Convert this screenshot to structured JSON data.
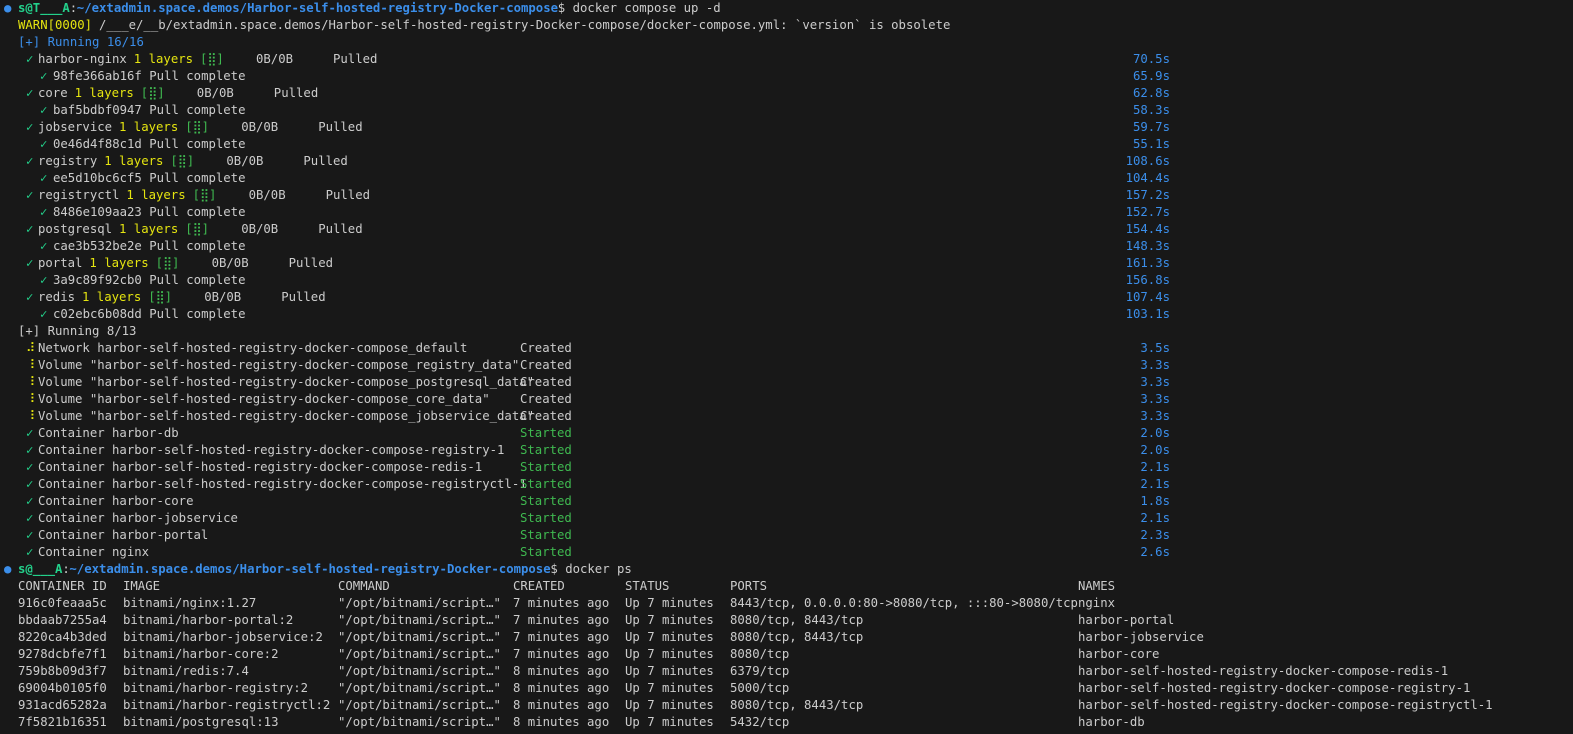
{
  "prompt1": {
    "dot": "●",
    "user_host": "s@T___A",
    "path": "~/extadmin.space.demos/Harbor-self-hosted-registry-Docker-compose",
    "suffix": "$",
    "command": "docker compose up -d"
  },
  "warn": {
    "prefix": "WARN[0000]",
    "text": "/___e/__b/extadmin.space.demos/Harbor-self-hosted-registry-Docker-compose/docker-compose.yml: `version` is obsolete"
  },
  "pull_header": "[+] Running 16/16",
  "pulls": [
    {
      "check": "✓",
      "service": "harbor-nginx",
      "layers": "1 layers",
      "box": "[⣿]",
      "size": "0B/0B",
      "state": "Pulled",
      "dur": "70.5s"
    },
    {
      "check": "✓",
      "layer": "98fe366ab16f Pull complete",
      "dur": "65.9s"
    },
    {
      "check": "✓",
      "service": "core",
      "layers": "1 layers",
      "box": "[⣿]",
      "size": "0B/0B",
      "state": "Pulled",
      "dur": "62.8s"
    },
    {
      "check": "✓",
      "layer": "baf5bdbf0947 Pull complete",
      "dur": "58.3s"
    },
    {
      "check": "✓",
      "service": "jobservice",
      "layers": "1 layers",
      "box": "[⣿]",
      "size": "0B/0B",
      "state": "Pulled",
      "dur": "59.7s"
    },
    {
      "check": "✓",
      "layer": "0e46d4f88c1d Pull complete",
      "dur": "55.1s"
    },
    {
      "check": "✓",
      "service": "registry",
      "layers": "1 layers",
      "box": "[⣿]",
      "size": "0B/0B",
      "state": "Pulled",
      "dur": "108.6s"
    },
    {
      "check": "✓",
      "layer": "ee5d10bc6cf5 Pull complete",
      "dur": "104.4s"
    },
    {
      "check": "✓",
      "service": "registryctl",
      "layers": "1 layers",
      "box": "[⣿]",
      "size": "0B/0B",
      "state": "Pulled",
      "dur": "157.2s"
    },
    {
      "check": "✓",
      "layer": "8486e109aa23 Pull complete",
      "dur": "152.7s"
    },
    {
      "check": "✓",
      "service": "postgresql",
      "layers": "1 layers",
      "box": "[⣿]",
      "size": "0B/0B",
      "state": "Pulled",
      "dur": "154.4s"
    },
    {
      "check": "✓",
      "layer": "cae3b532be2e Pull complete",
      "dur": "148.3s"
    },
    {
      "check": "✓",
      "service": "portal",
      "layers": "1 layers",
      "box": "[⣿]",
      "size": "0B/0B",
      "state": "Pulled",
      "dur": "161.3s"
    },
    {
      "check": "✓",
      "layer": "3a9c89f92cb0 Pull complete",
      "dur": "156.8s"
    },
    {
      "check": "✓",
      "service": "redis",
      "layers": "1 layers",
      "box": "[⣿]",
      "size": "0B/0B",
      "state": "Pulled",
      "dur": "107.4s"
    },
    {
      "check": "✓",
      "layer": "c02ebc6b08dd Pull complete",
      "dur": "103.1s"
    }
  ],
  "run_header": "[+] Running 8/13",
  "resources": [
    {
      "icon": "⠼",
      "name": "Network harbor-self-hosted-registry-docker-compose_default",
      "state": "Created",
      "dur": "3.5s",
      "started": false
    },
    {
      "icon": "⠸",
      "name": "Volume \"harbor-self-hosted-registry-docker-compose_registry_data\"",
      "state": "Created",
      "dur": "3.3s",
      "started": false
    },
    {
      "icon": "⠸",
      "name": "Volume \"harbor-self-hosted-registry-docker-compose_postgresql_data\"",
      "state": "Created",
      "dur": "3.3s",
      "started": false
    },
    {
      "icon": "⠸",
      "name": "Volume \"harbor-self-hosted-registry-docker-compose_core_data\"",
      "state": "Created",
      "dur": "3.3s",
      "started": false
    },
    {
      "icon": "⠸",
      "name": "Volume \"harbor-self-hosted-registry-docker-compose_jobservice_data\"",
      "state": "Created",
      "dur": "3.3s",
      "started": false
    },
    {
      "icon": "✓",
      "name": "Container harbor-db",
      "state": "Started",
      "dur": "2.0s",
      "started": true
    },
    {
      "icon": "✓",
      "name": "Container harbor-self-hosted-registry-docker-compose-registry-1",
      "state": "Started",
      "dur": "2.0s",
      "started": true
    },
    {
      "icon": "✓",
      "name": "Container harbor-self-hosted-registry-docker-compose-redis-1",
      "state": "Started",
      "dur": "2.1s",
      "started": true
    },
    {
      "icon": "✓",
      "name": "Container harbor-self-hosted-registry-docker-compose-registryctl-1",
      "state": "Started",
      "dur": "2.1s",
      "started": true
    },
    {
      "icon": "✓",
      "name": "Container harbor-core",
      "state": "Started",
      "dur": "1.8s",
      "started": true
    },
    {
      "icon": "✓",
      "name": "Container harbor-jobservice",
      "state": "Started",
      "dur": "2.1s",
      "started": true
    },
    {
      "icon": "✓",
      "name": "Container harbor-portal",
      "state": "Started",
      "dur": "2.3s",
      "started": true
    },
    {
      "icon": "✓",
      "name": "Container nginx",
      "state": "Started",
      "dur": "2.6s",
      "started": true
    }
  ],
  "prompt2": {
    "dot": "●",
    "user_host": "s@___A",
    "path": "~/extadmin.space.demos/Harbor-self-hosted-registry-Docker-compose",
    "suffix": "$",
    "command": "docker ps"
  },
  "ps": {
    "headers": [
      "CONTAINER ID",
      "IMAGE",
      "COMMAND",
      "CREATED",
      "STATUS",
      "PORTS",
      "NAMES"
    ],
    "rows": [
      [
        "916c0feaaa5c",
        "bitnami/nginx:1.27",
        "\"/opt/bitnami/script…\"",
        "7 minutes ago",
        "Up 7 minutes",
        "8443/tcp, 0.0.0.0:80->8080/tcp, :::80->8080/tcp",
        "nginx"
      ],
      [
        "bbdaab7255a4",
        "bitnami/harbor-portal:2",
        "\"/opt/bitnami/script…\"",
        "7 minutes ago",
        "Up 7 minutes",
        "8080/tcp, 8443/tcp",
        "harbor-portal"
      ],
      [
        "8220ca4b3ded",
        "bitnami/harbor-jobservice:2",
        "\"/opt/bitnami/script…\"",
        "7 minutes ago",
        "Up 7 minutes",
        "8080/tcp, 8443/tcp",
        "harbor-jobservice"
      ],
      [
        "9278dcbfe7f1",
        "bitnami/harbor-core:2",
        "\"/opt/bitnami/script…\"",
        "7 minutes ago",
        "Up 7 minutes",
        "8080/tcp",
        "harbor-core"
      ],
      [
        "759b8b09d3f7",
        "bitnami/redis:7.4",
        "\"/opt/bitnami/script…\"",
        "8 minutes ago",
        "Up 7 minutes",
        "6379/tcp",
        "harbor-self-hosted-registry-docker-compose-redis-1"
      ],
      [
        "69004b0105f0",
        "bitnami/harbor-registry:2",
        "\"/opt/bitnami/script…\"",
        "8 minutes ago",
        "Up 7 minutes",
        "5000/tcp",
        "harbor-self-hosted-registry-docker-compose-registry-1"
      ],
      [
        "931acd65282a",
        "bitnami/harbor-registryctl:2",
        "\"/opt/bitnami/script…\"",
        "8 minutes ago",
        "Up 7 minutes",
        "8080/tcp, 8443/tcp",
        "harbor-self-hosted-registry-docker-compose-registryctl-1"
      ],
      [
        "7f5821b16351",
        "bitnami/postgresql:13",
        "\"/opt/bitnami/script…\"",
        "8 minutes ago",
        "Up 7 minutes",
        "5432/tcp",
        "harbor-db"
      ]
    ]
  }
}
